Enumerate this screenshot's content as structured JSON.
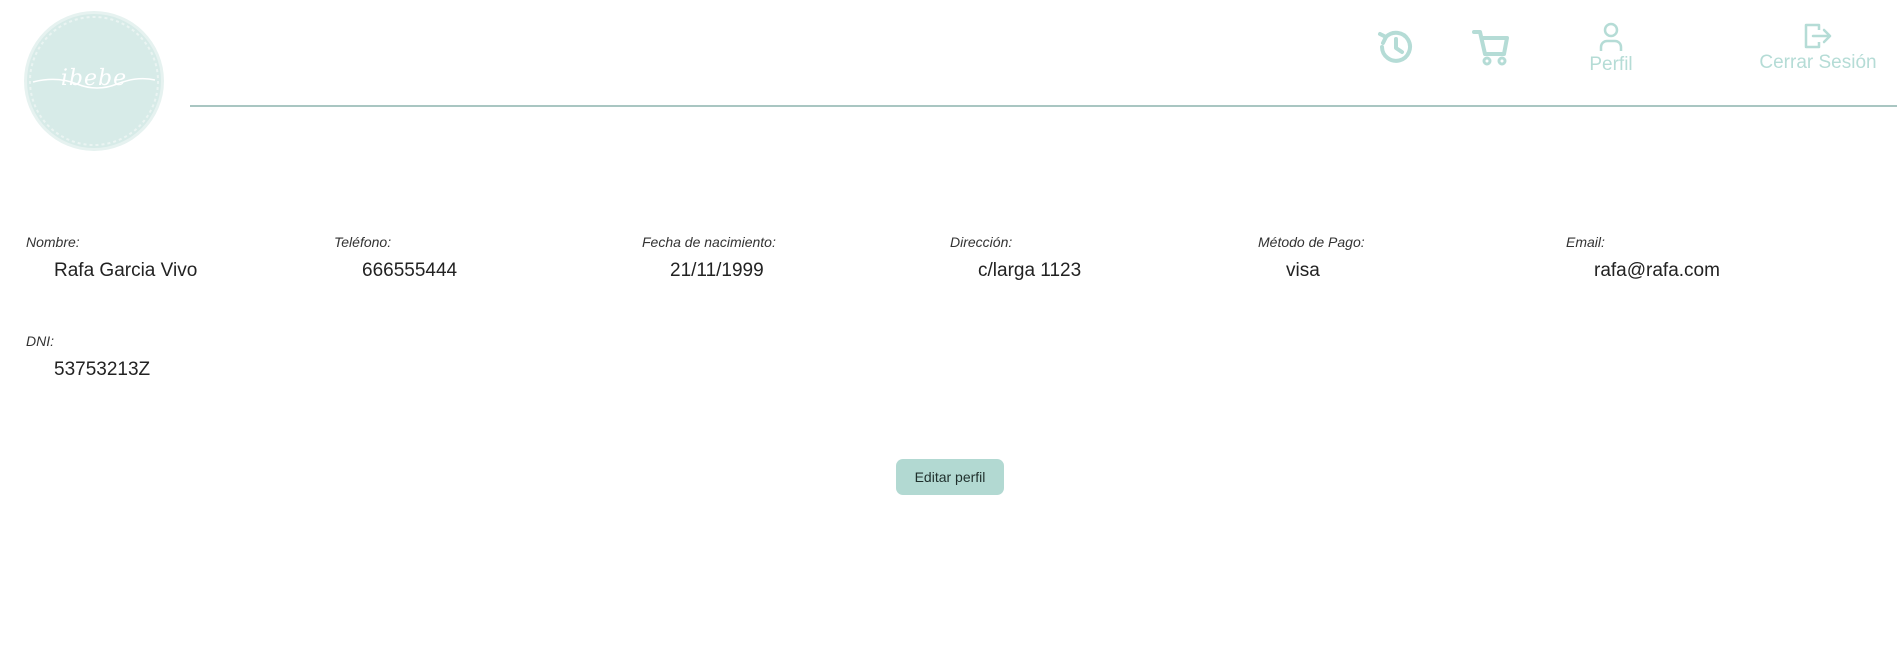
{
  "header": {
    "logo_text": "ibebe",
    "nav": {
      "history_icon": "history-icon",
      "cart_icon": "cart-icon",
      "perfil_label": "Perfil",
      "logout_label": "Cerrar Sesión"
    },
    "accent_color": "#b5dcd6"
  },
  "profile": {
    "nombre": {
      "label": "Nombre:",
      "value": "Rafa Garcia Vivo"
    },
    "telefono": {
      "label": "Teléfono:",
      "value": "666555444"
    },
    "fecha": {
      "label": "Fecha de nacimiento:",
      "value": "21/11/1999"
    },
    "direccion": {
      "label": "Dirección:",
      "value": "c/larga 1123"
    },
    "metodo_pago": {
      "label": "Método de Pago:",
      "value": "visa"
    },
    "email": {
      "label": "Email:",
      "value": "rafa@rafa.com"
    },
    "dni": {
      "label": "DNI:",
      "value": "53753213Z"
    }
  },
  "actions": {
    "edit_label": "Editar perfil",
    "button_color": "#b2d9d2"
  }
}
